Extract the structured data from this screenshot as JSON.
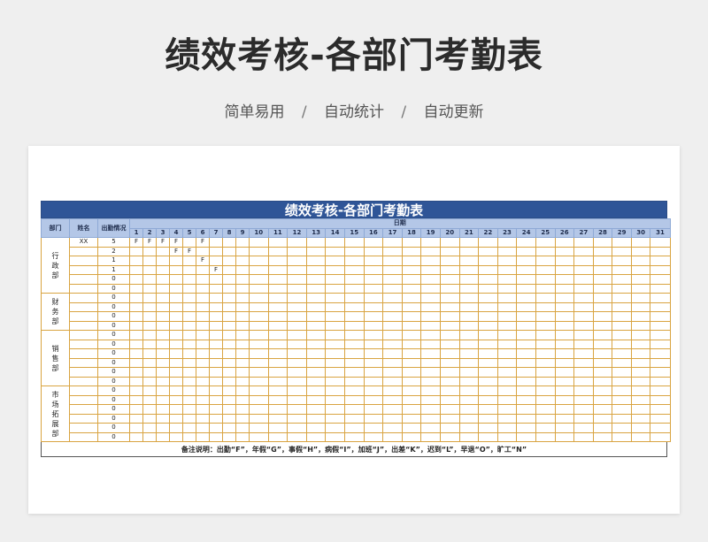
{
  "banner": {
    "title": "绩效考核-各部门考勤表",
    "tags": [
      "简单易用",
      "自动统计",
      "自动更新"
    ],
    "separator": "/"
  },
  "sheet": {
    "title": "绩效考核-各部门考勤表",
    "headers": {
      "dept": "部门",
      "name": "姓名",
      "attendance": "出勤情况",
      "date": "日期"
    },
    "days": [
      "1",
      "2",
      "3",
      "4",
      "5",
      "6",
      "7",
      "8",
      "9",
      "10",
      "11",
      "12",
      "13",
      "14",
      "15",
      "16",
      "17",
      "18",
      "19",
      "20",
      "21",
      "22",
      "23",
      "24",
      "25",
      "26",
      "27",
      "28",
      "29",
      "30",
      "31"
    ],
    "departments": [
      {
        "name": "行政部",
        "rows": [
          {
            "name": "XX",
            "count": "5",
            "marks": [
              "F",
              "F",
              "F",
              "F",
              "",
              "F"
            ]
          },
          {
            "name": "",
            "count": "2",
            "marks": [
              "",
              "",
              "",
              "F",
              "F",
              ""
            ]
          },
          {
            "name": "",
            "count": "1",
            "marks": [
              "",
              "",
              "",
              "",
              "",
              "F"
            ]
          },
          {
            "name": "",
            "count": "1",
            "marks": [
              "",
              "",
              "",
              "",
              "",
              "",
              "F"
            ]
          },
          {
            "name": "",
            "count": "0",
            "marks": []
          },
          {
            "name": "",
            "count": "0",
            "marks": []
          }
        ]
      },
      {
        "name": "财务部",
        "rows": [
          {
            "name": "",
            "count": "0",
            "marks": []
          },
          {
            "name": "",
            "count": "0",
            "marks": []
          },
          {
            "name": "",
            "count": "0",
            "marks": []
          },
          {
            "name": "",
            "count": "0",
            "marks": []
          }
        ]
      },
      {
        "name": "销售部",
        "rows": [
          {
            "name": "",
            "count": "0",
            "marks": []
          },
          {
            "name": "",
            "count": "0",
            "marks": []
          },
          {
            "name": "",
            "count": "0",
            "marks": []
          },
          {
            "name": "",
            "count": "0",
            "marks": []
          },
          {
            "name": "",
            "count": "0",
            "marks": []
          },
          {
            "name": "",
            "count": "0",
            "marks": []
          }
        ]
      },
      {
        "name": "市场拓展部",
        "rows": [
          {
            "name": "",
            "count": "0",
            "marks": []
          },
          {
            "name": "",
            "count": "0",
            "marks": []
          },
          {
            "name": "",
            "count": "0",
            "marks": []
          },
          {
            "name": "",
            "count": "0",
            "marks": []
          },
          {
            "name": "",
            "count": "0",
            "marks": []
          },
          {
            "name": "",
            "count": "0",
            "marks": []
          }
        ]
      }
    ],
    "note": "备注说明：出勤“F”，年假“G”，事假“H”，病假“I”，加班“J”，出差“K”，迟到“L”，早退“O”，旷工“N”"
  },
  "colors": {
    "header_bar": "#2f5597",
    "header_cell": "#b4c7e7",
    "grid": "#d9a441"
  }
}
